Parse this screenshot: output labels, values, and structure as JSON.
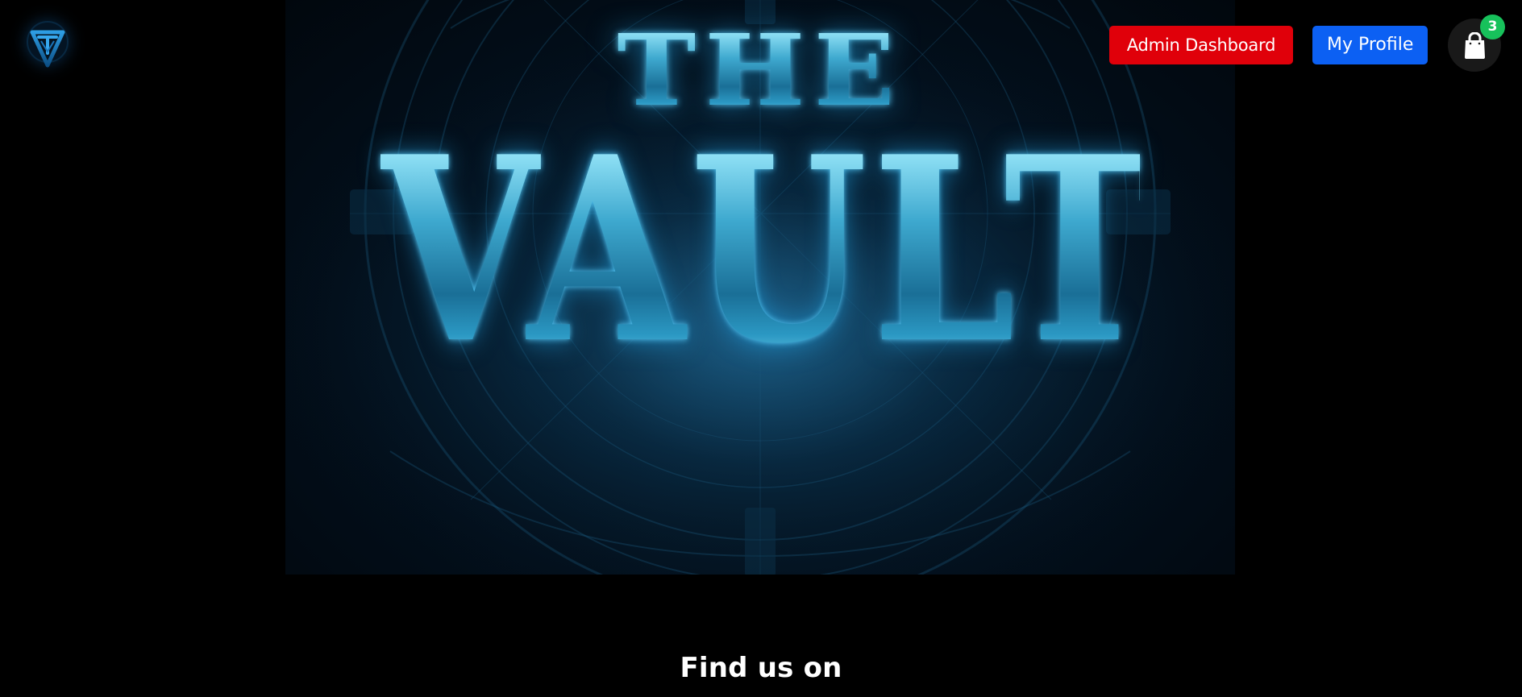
{
  "header": {
    "logo_icon": "vault-logo-icon",
    "admin_dashboard_label": "Admin Dashboard",
    "my_profile_label": "My Profile",
    "cart": {
      "icon": "shopping-bag-icon",
      "count": "3"
    }
  },
  "hero": {
    "title_line_1": "THE",
    "title_line_2": "VAULT"
  },
  "footer": {
    "find_us_label": "Find us on"
  },
  "colors": {
    "background": "#000000",
    "admin_button": "#e0000a",
    "profile_button": "#0c60f3",
    "cart_background": "#191919",
    "cart_badge": "#17c15b",
    "hero_glow": "#2a91c2"
  }
}
